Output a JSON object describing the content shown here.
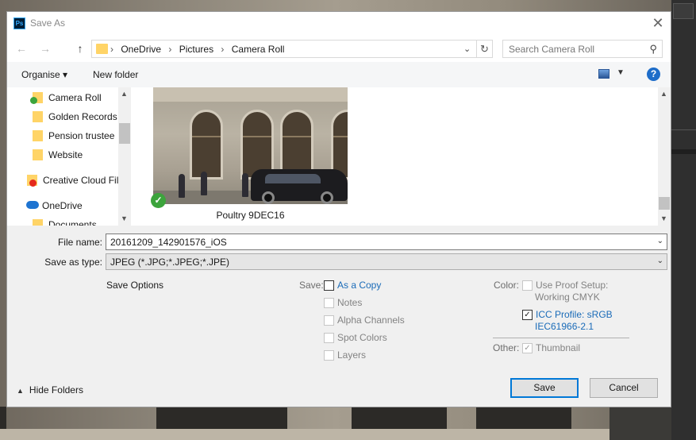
{
  "window": {
    "title": "Save As",
    "app_icon": "Ps",
    "close_icon": "close-icon"
  },
  "nav": {
    "back_icon": "←",
    "forward_icon": "→",
    "up_icon": "↑",
    "breadcrumbs": [
      "OneDrive",
      "Pictures",
      "Camera Roll"
    ],
    "separator": "›",
    "search_placeholder": "Search Camera Roll"
  },
  "toolbar": {
    "organise_label": "Organise ▾",
    "new_folder_label": "New folder",
    "help_label": "?"
  },
  "tree": {
    "items": [
      {
        "label": "Camera Roll"
      },
      {
        "label": "Golden Records"
      },
      {
        "label": "Pension trustee"
      },
      {
        "label": "Website"
      },
      {
        "label": "Creative Cloud Fil"
      },
      {
        "label": "OneDrive"
      },
      {
        "label": "Documents"
      }
    ]
  },
  "files": {
    "items": [
      {
        "label": "Poultry 9DEC16",
        "synced": true
      }
    ]
  },
  "form": {
    "file_name_label": "File name:",
    "file_name_value": "20161209_142901576_iOS",
    "save_as_type_label": "Save as type:",
    "save_as_type_value": "JPEG (*.JPG;*.JPEG;*.JPE)"
  },
  "options": {
    "title": "Save Options",
    "save_label": "Save:",
    "save_items": [
      {
        "label": "As a Copy",
        "checked": false,
        "enabled": true
      },
      {
        "label": "Notes",
        "checked": false,
        "enabled": false
      },
      {
        "label": "Alpha Channels",
        "checked": false,
        "enabled": false
      },
      {
        "label": "Spot Colors",
        "checked": false,
        "enabled": false
      },
      {
        "label": "Layers",
        "checked": false,
        "enabled": false
      }
    ],
    "color_label": "Color:",
    "proof_setup_line1": "Use Proof Setup:",
    "proof_setup_line2": "Working CMYK",
    "icc_line1": "ICC Profile:  sRGB",
    "icc_line2": "IEC61966-2.1",
    "other_label": "Other:",
    "thumbnail_label": "Thumbnail"
  },
  "footer": {
    "hide_folders_label": "Hide Folders",
    "save_label": "Save",
    "cancel_label": "Cancel"
  },
  "colors": {
    "accent": "#0078d7",
    "link": "#1a6bb8",
    "sync_green": "#3ca43c"
  }
}
